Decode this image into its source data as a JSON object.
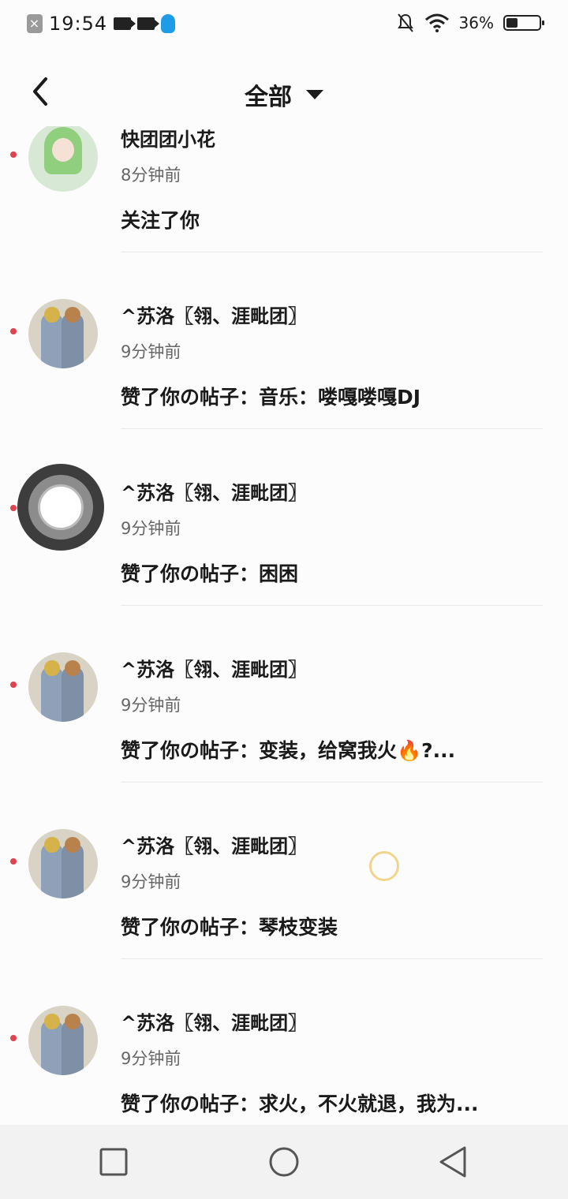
{
  "status_bar": {
    "time": "19:54",
    "battery": "36%",
    "battery_level": 0.36
  },
  "header": {
    "title": "全部"
  },
  "notifications": [
    {
      "name": "快团团小花",
      "time": "8分钟前",
      "message": "关注了你",
      "avatar": "green-hair-avatar"
    },
    {
      "name": "^苏洛〖翎、涯毗团〗",
      "time": "9分钟前",
      "message": "赞了你の帖子：音乐：喽嘎喽嘎DJ",
      "avatar": "two-people-avatar"
    },
    {
      "name": "^苏洛〖翎、涯毗团〗",
      "time": "9分钟前",
      "message": "赞了你の帖子：困困",
      "avatar": "ring-avatar"
    },
    {
      "name": "^苏洛〖翎、涯毗团〗",
      "time": "9分钟前",
      "message": "赞了你の帖子：变装，给窝我火🔥?...",
      "avatar": "two-people-avatar"
    },
    {
      "name": "^苏洛〖翎、涯毗团〗",
      "time": "9分钟前",
      "message": "赞了你の帖子：琴枝变装",
      "avatar": "two-people-avatar"
    },
    {
      "name": "^苏洛〖翎、涯毗团〗",
      "time": "9分钟前",
      "message": "赞了你の帖子：求火，不火就退，我为...",
      "avatar": "two-people-avatar"
    }
  ],
  "nav": {
    "icons": [
      "recents-icon",
      "home-icon",
      "back-icon"
    ]
  },
  "colors": {
    "unread_dot": "#e0434f",
    "text": "#1a1a1a",
    "secondary_text": "#666666"
  }
}
